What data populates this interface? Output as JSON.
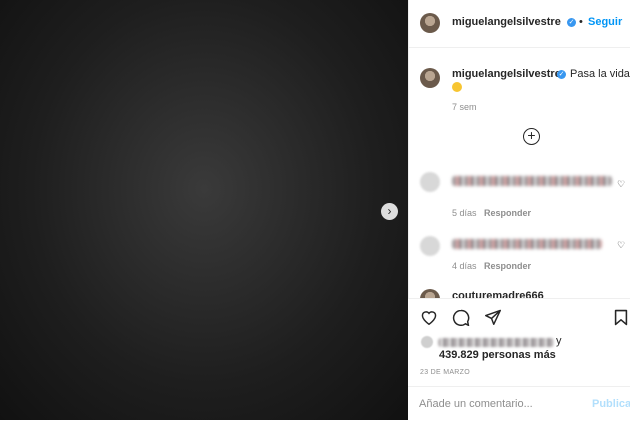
{
  "header": {
    "username": "miguelangelsilvestre",
    "separator": "•",
    "follow_label": "Seguir",
    "verified_symbol": "✓"
  },
  "caption": {
    "username": "miguelangelsilvestre",
    "text": "Pasa la vida...",
    "emoji": "smiling-face-emoji",
    "time": "7 sem"
  },
  "comments": [
    {
      "time": "5 días",
      "reply_label": "Responder"
    },
    {
      "time": "4 días",
      "reply_label": "Responder"
    },
    {
      "partial_username": "couturemadre666"
    }
  ],
  "actions": {
    "icons": [
      "heart-icon",
      "comment-icon",
      "share-icon",
      "save-icon"
    ],
    "likes_connector": "y",
    "likes_count": "439.829 personas más",
    "date": "23 DE MARZO"
  },
  "comment_box": {
    "placeholder": "Añade un comentario...",
    "publish_label": "Publicar"
  },
  "colors": {
    "accent": "#0095f6",
    "verified": "#3897f0",
    "muted": "#8e8e8e",
    "text": "#262626"
  }
}
